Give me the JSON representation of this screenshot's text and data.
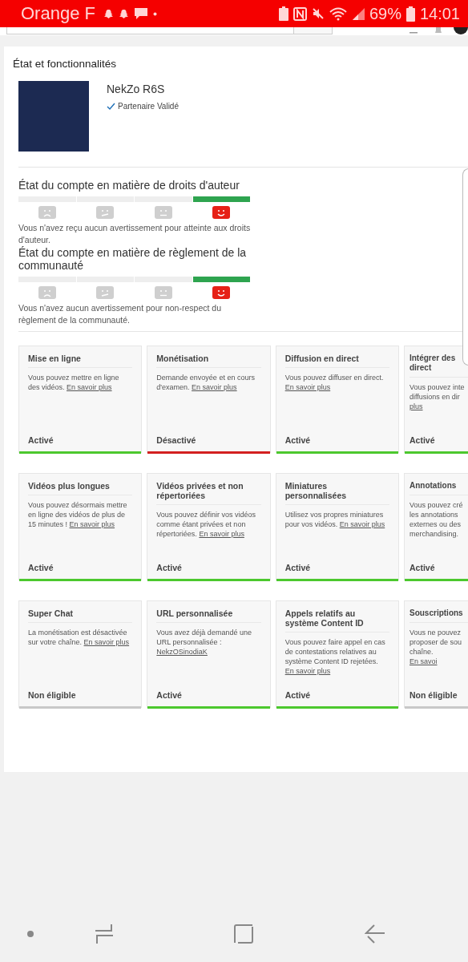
{
  "status_bar": {
    "carrier": "Orange F",
    "battery": "69%",
    "time": "14:01"
  },
  "page": {
    "title": "État et fonctionnalités"
  },
  "channel": {
    "name": "NekZo R6S",
    "badge": "Partenaire Validé"
  },
  "strike_sections": [
    {
      "title": "État du compte en matière de droits d'auteur",
      "message": "Vous n'avez reçu aucun avertissement pour atteinte aux droits d'auteur.",
      "levels": [
        {
          "kind": "sad",
          "selected": false
        },
        {
          "kind": "skeptical",
          "selected": false
        },
        {
          "kind": "neutral",
          "selected": false
        },
        {
          "kind": "happy",
          "selected": true
        }
      ]
    },
    {
      "title": "État du compte en matière de règlement de la communauté",
      "message": "Vous n'avez aucun avertissement pour non-respect du règlement de la communauté.",
      "levels": [
        {
          "kind": "sad",
          "selected": false
        },
        {
          "kind": "skeptical",
          "selected": false
        },
        {
          "kind": "neutral",
          "selected": false
        },
        {
          "kind": "happy",
          "selected": true
        }
      ]
    }
  ],
  "features": [
    [
      {
        "title": "Mise en ligne",
        "text": "Vous pouvez mettre en ligne des vidéos.",
        "link": "En savoir plus",
        "status": "Activé",
        "color": "#4cc82e"
      },
      {
        "title": "Monétisation",
        "text": "Demande envoyée et en cours d'examen.",
        "link": "En savoir plus",
        "status": "Désactivé",
        "color": "#d32020"
      },
      {
        "title": "Diffusion en direct",
        "text": "Vous pouvez diffuser en direct.",
        "link": "En savoir plus",
        "status": "Activé",
        "color": "#4cc82e"
      },
      {
        "title_lines": [
          "Intégrer des",
          "direct"
        ],
        "text_lines": [
          "Vous pouvez inte",
          "diffusions en dir"
        ],
        "link": "plus",
        "status": "Activé",
        "color": "#4cc82e"
      }
    ],
    [
      {
        "title": "Vidéos plus longues",
        "text": "Vous pouvez désormais mettre en ligne des vidéos de plus de 15 minutes !",
        "link": "En savoir plus",
        "status": "Activé",
        "color": "#4cc82e"
      },
      {
        "title": "Vidéos privées et non répertoriées",
        "text": "Vous pouvez définir vos vidéos comme étant privées et non répertoriées.",
        "link": "En savoir plus",
        "status": "Activé",
        "color": "#4cc82e"
      },
      {
        "title": "Miniatures personnalisées",
        "text": "Utilisez vos propres miniatures pour vos vidéos.",
        "link": "En savoir plus",
        "status": "Activé",
        "color": "#4cc82e"
      },
      {
        "title_lines": [
          "Annotations"
        ],
        "text_lines": [
          "Vous pouvez cré",
          "les annotations",
          "externes ou des",
          "merchandising."
        ],
        "status": "Activé",
        "color": "#4cc82e"
      }
    ],
    [
      {
        "title": "Super Chat",
        "text": "La monétisation est désactivée sur votre chaîne.",
        "link": "En savoir plus",
        "status": "Non éligible",
        "color": "#c8c8c8"
      },
      {
        "title": "URL personnalisée",
        "text": "Vous avez déjà demandé une URL personnalisée :",
        "link": "NekzOSinodiaK",
        "status": "Activé",
        "color": "#4cc82e"
      },
      {
        "title": "Appels relatifs au système Content ID",
        "text": "Vous pouvez faire appel en cas de contestations relatives au système Content ID rejetées.",
        "link": "En savoir plus",
        "status": "Activé",
        "color": "#4cc82e"
      },
      {
        "title_lines": [
          "Souscriptions"
        ],
        "text_lines": [
          "Vous ne pouvez",
          "proposer de sou",
          "chaîne."
        ],
        "link": "En savoi",
        "status": "Non éligible",
        "color": "#c8c8c8"
      }
    ]
  ]
}
